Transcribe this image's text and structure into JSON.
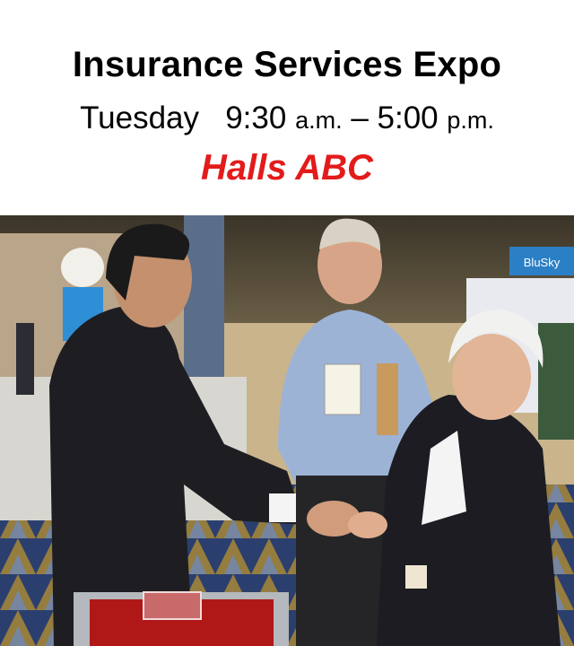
{
  "header": {
    "title": "Insurance Services Expo",
    "day": "Tuesday",
    "start_time": "9:30",
    "start_suffix": "a.m.",
    "dash": "–",
    "end_time": "5:00",
    "end_suffix": "p.m.",
    "venue": "Halls ABC"
  },
  "photo": {
    "booth_sign": "BluSky",
    "colors": {
      "venue_red": "#e31b1b",
      "carpet_blue": "#2a3f6e",
      "carpet_gold": "#b8902e",
      "table_red": "#b01818"
    }
  }
}
